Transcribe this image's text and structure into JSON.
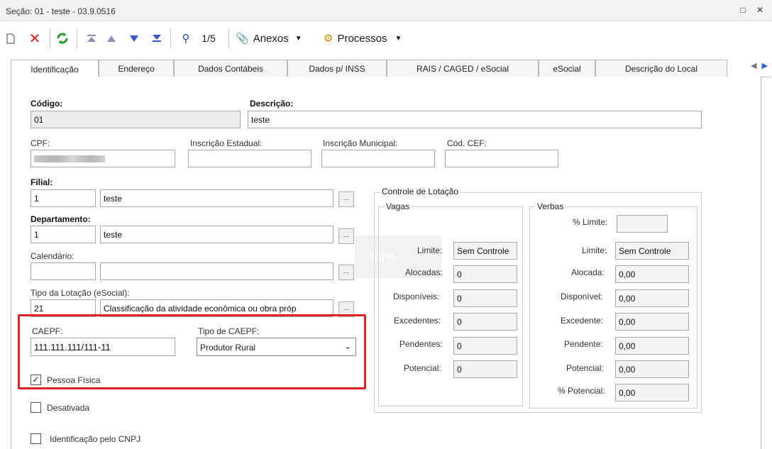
{
  "window": {
    "title": "Seção: 01 - teste - 03.9.0516",
    "controls": "□ ✕"
  },
  "toolbar": {
    "record_counter": "1/5",
    "anexos_label": "Anexos",
    "processos_label": "Processos"
  },
  "tabs": [
    {
      "label": "Identificação"
    },
    {
      "label": "Endereço"
    },
    {
      "label": "Dados Contábeis"
    },
    {
      "label": "Dados p/ INSS"
    },
    {
      "label": "RAIS / CAGED / eSocial"
    },
    {
      "label": "eSocial"
    },
    {
      "label": "Descrição do Local"
    }
  ],
  "form": {
    "codigo_label": "Código:",
    "codigo_value": "01",
    "descricao_label": "Descrição:",
    "descricao_value": "teste",
    "cpf_label": "CPF:",
    "insc_estadual_label": "Inscrição Estadual:",
    "insc_municipal_label": "Inscrição Municipal:",
    "cod_cef_label": "Cód. CEF:",
    "filial_label": "Filial:",
    "filial_code": "1",
    "filial_name": "teste",
    "departamento_label": "Departamento:",
    "departamento_code": "1",
    "departamento_name": "teste",
    "calendario_label": "Calendário:",
    "tipo_lotacao_label": "Tipo da Lotação (eSocial):",
    "tipo_lotacao_code": "21",
    "tipo_lotacao_desc": "Classificação da atividade econômica ou obra próp",
    "caepf_label": "CAEPF:",
    "caepf_value": "111.111.111/111-11",
    "tipo_caepf_label": "Tipo de CAEPF:",
    "tipo_caepf_value": "Produtor Rural",
    "pessoa_fisica_label": "Pessoa Física",
    "desativada_label": "Desativada",
    "identificacao_cnpj_label": "Identificação pelo CNPJ",
    "overlay_percent": "89%"
  },
  "controle_lotacao": {
    "title": "Controle de Lotação",
    "vagas": {
      "title": "Vagas",
      "limite_label": "Limite:",
      "limite_value": "Sem Controle",
      "alocadas_label": "Alocadas:",
      "alocadas_value": "0",
      "disponiveis_label": "Disponíveis:",
      "disponiveis_value": "0",
      "excedentes_label": "Excedentes:",
      "excedentes_value": "0",
      "pendentes_label": "Pendentes:",
      "pendentes_value": "0",
      "potencial_label": "Potencial:",
      "potencial_value": "0"
    },
    "verbas": {
      "title": "Verbas",
      "pct_limite_label": "% Limite:",
      "limite_label": "Limite:",
      "limite_value": "Sem Controle",
      "alocada_label": "Alocada:",
      "alocada_value": "0,00",
      "disponivel_label": "Disponível:",
      "disponivel_value": "0,00",
      "excedente_label": "Excedente:",
      "excedente_value": "0,00",
      "pendente_label": "Pendente:",
      "pendente_value": "0,00",
      "potencial_label": "Potencial:",
      "potencial_value": "0,00",
      "pct_potencial_label": "% Potencial:",
      "pct_potencial_value": "0,00"
    }
  },
  "colors": {
    "highlight": "#e0202a",
    "tab_border": "#b9b9b9"
  }
}
